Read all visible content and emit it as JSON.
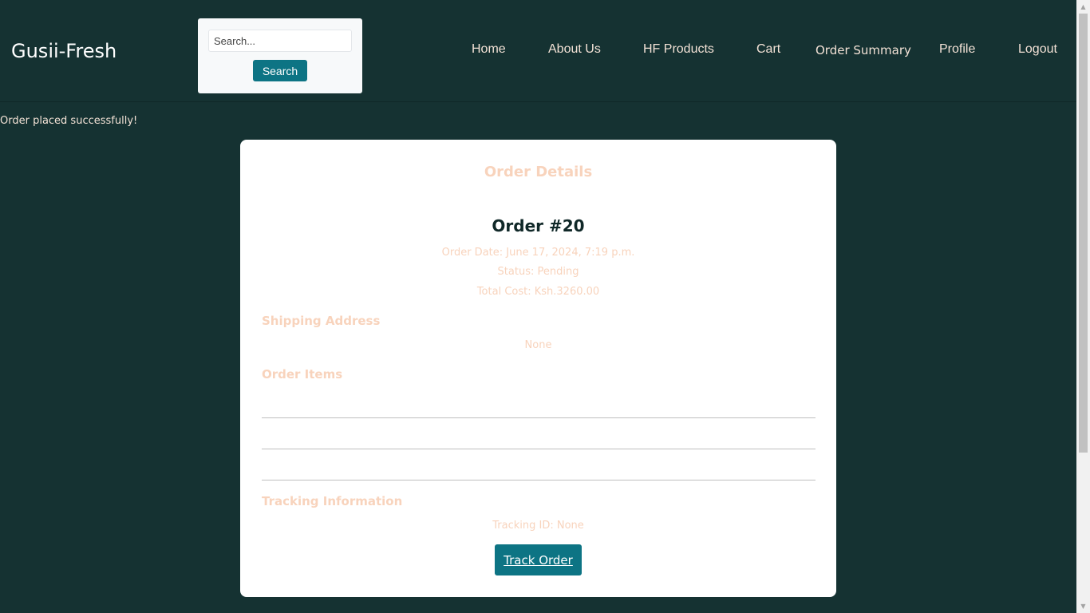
{
  "header": {
    "brand": "Gusii-Fresh",
    "search": {
      "placeholder": "Search...",
      "button_label": "Search"
    },
    "nav": {
      "home": "Home",
      "about": "About Us",
      "products": "HF Products",
      "cart": "Cart",
      "order_summary": "Order Summary",
      "profile": "Profile",
      "logout": "Logout"
    }
  },
  "flash_message": "Order placed successfully!",
  "order": {
    "title": "Order Details",
    "number": "Order #20",
    "date": "Order Date: June 17, 2024, 7:19 p.m.",
    "status": "Status: Pending",
    "total": "Total Cost: Ksh.3260.00",
    "shipping_heading": "Shipping Address",
    "shipping_value": "None",
    "items_heading": "Order Items",
    "tracking_heading": "Tracking Information",
    "tracking_id": "Tracking ID: None",
    "track_button": "Track Order"
  },
  "colors": {
    "background": "#153232",
    "accent": "#0d7484",
    "muted_text": "#f8d3bc"
  }
}
